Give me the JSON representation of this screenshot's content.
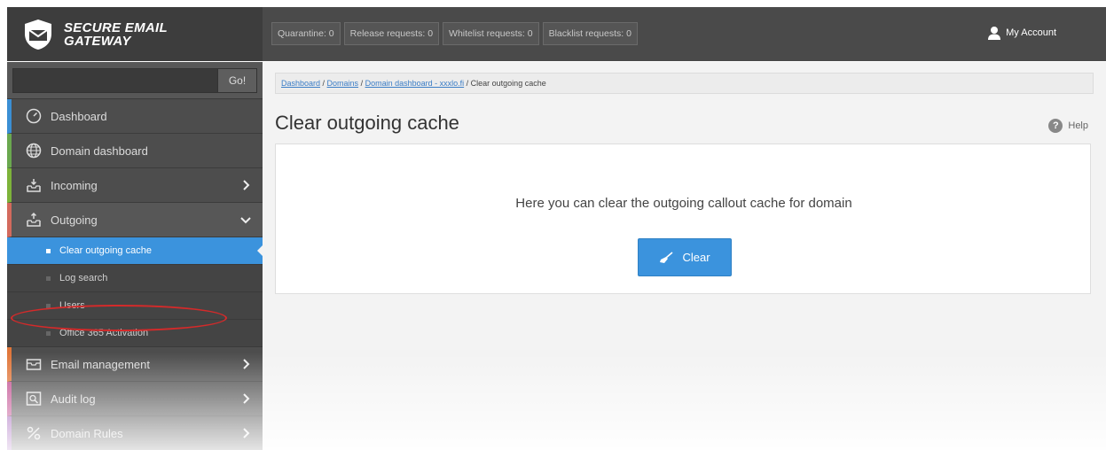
{
  "brand": {
    "line1": "SECURE EMAIL",
    "line2": "GATEWAY"
  },
  "header": {
    "counters": [
      "Quarantine: 0",
      "Release requests: 0",
      "Whitelist requests: 0",
      "Blacklist requests: 0"
    ],
    "account_label": "My Account"
  },
  "sidebar": {
    "search": {
      "value": "",
      "placeholder": "",
      "button": "Go!"
    },
    "items": [
      {
        "label": "Dashboard",
        "icon": "dashboard-icon"
      },
      {
        "label": "Domain dashboard",
        "icon": "globe-icon"
      },
      {
        "label": "Incoming",
        "icon": "inbox-icon"
      },
      {
        "label": "Outgoing",
        "icon": "outbox-icon"
      },
      {
        "label": "Email management",
        "icon": "envelope-icon"
      },
      {
        "label": "Audit log",
        "icon": "audit-icon"
      },
      {
        "label": "Domain Rules",
        "icon": "percent-icon"
      }
    ],
    "outgoing_sub": [
      {
        "label": "Clear outgoing cache",
        "active": true
      },
      {
        "label": "Log search",
        "active": false
      },
      {
        "label": "Users",
        "active": false
      },
      {
        "label": "Office 365 Activation",
        "active": false
      }
    ]
  },
  "breadcrumb": {
    "links": [
      "Dashboard",
      "Domains",
      "Domain dashboard - xxxlo.fi"
    ],
    "separator": " / ",
    "current": "Clear outgoing cache"
  },
  "page": {
    "title": "Clear outgoing cache",
    "help": "Help",
    "description": "Here you can clear the outgoing callout cache for domain",
    "clear_button": "Clear"
  },
  "colors": {
    "accent": "#3b93dd",
    "header_bg": "#4a4a4a",
    "sidebar_bg": "#4d4d4d",
    "highlight_ring": "#d42a2a"
  }
}
